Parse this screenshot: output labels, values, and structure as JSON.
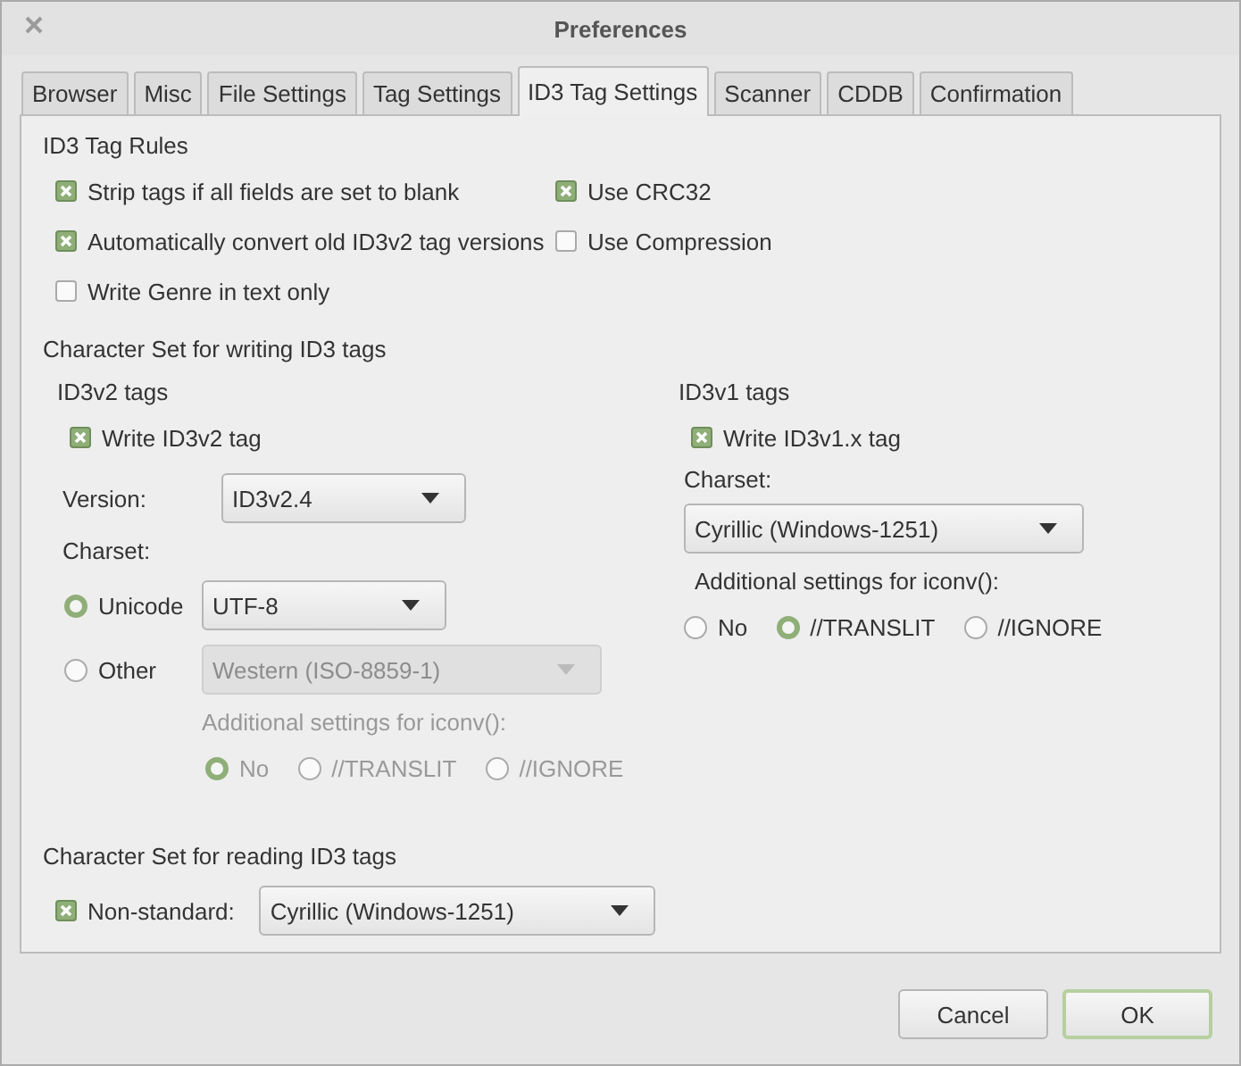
{
  "window": {
    "title": "Preferences"
  },
  "tabs": [
    {
      "label": "Browser",
      "selected": false
    },
    {
      "label": "Misc",
      "selected": false
    },
    {
      "label": "File Settings",
      "selected": false
    },
    {
      "label": "Tag Settings",
      "selected": false
    },
    {
      "label": "ID3 Tag Settings",
      "selected": true
    },
    {
      "label": "Scanner",
      "selected": false
    },
    {
      "label": "CDDB",
      "selected": false
    },
    {
      "label": "Confirmation",
      "selected": false
    }
  ],
  "id3_tag_rules": {
    "title": "ID3 Tag Rules",
    "options": [
      {
        "label": "Strip tags if all fields are set to blank",
        "checked": true
      },
      {
        "label": "Use CRC32",
        "checked": true
      },
      {
        "label": "Automatically convert old ID3v2 tag versions",
        "checked": true
      },
      {
        "label": "Use Compression",
        "checked": false
      },
      {
        "label": "Write Genre in text only",
        "checked": false
      }
    ]
  },
  "writing_charset": {
    "title": "Character Set for writing ID3 tags",
    "id3v2": {
      "title": "ID3v2 tags",
      "write": {
        "label": "Write ID3v2 tag",
        "checked": true
      },
      "version_label": "Version:",
      "version": "ID3v2.4",
      "charset_label": "Charset:",
      "charset_options": [
        {
          "label": "Unicode",
          "selected": true,
          "value": "UTF-8",
          "disabled": false
        },
        {
          "label": "Other",
          "selected": false,
          "value": "Western (ISO-8859-1)",
          "disabled": true
        }
      ],
      "iconv": {
        "label": "Additional settings for iconv():",
        "disabled": true,
        "options": [
          {
            "label": "No",
            "selected": true
          },
          {
            "label": "//TRANSLIT",
            "selected": false
          },
          {
            "label": "//IGNORE",
            "selected": false
          }
        ]
      }
    },
    "id3v1": {
      "title": "ID3v1 tags",
      "write": {
        "label": "Write ID3v1.x tag",
        "checked": true
      },
      "charset_label": "Charset:",
      "charset": "Cyrillic (Windows-1251)",
      "iconv": {
        "label": "Additional settings for iconv():",
        "disabled": false,
        "options": [
          {
            "label": "No",
            "selected": false
          },
          {
            "label": "//TRANSLIT",
            "selected": true
          },
          {
            "label": "//IGNORE",
            "selected": false
          }
        ]
      }
    }
  },
  "reading_charset": {
    "title": "Character Set for reading ID3 tags",
    "non_standard": {
      "label": "Non-standard:",
      "checked": true,
      "value": "Cyrillic (Windows-1251)"
    }
  },
  "buttons": [
    {
      "label": "Cancel",
      "default": false
    },
    {
      "label": "OK",
      "default": true
    }
  ]
}
